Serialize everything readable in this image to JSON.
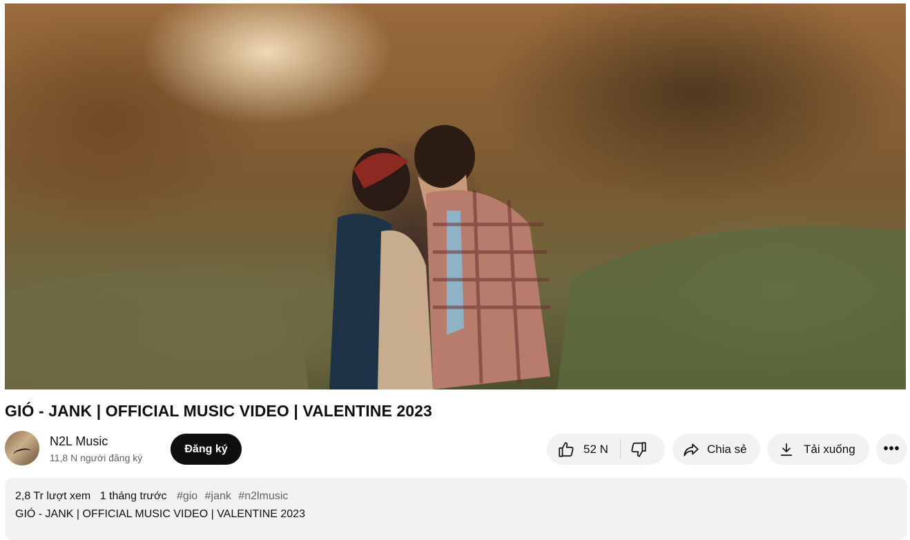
{
  "video": {
    "title": "GIÓ - JANK | OFFICIAL MUSIC VIDEO | VALENTINE 2023"
  },
  "channel": {
    "name": "N2L Music",
    "subscribers": "11,8 N người đăng ký",
    "subscribe_label": "Đăng ký"
  },
  "actions": {
    "like_count": "52 N",
    "share_label": "Chia sẻ",
    "download_label": "Tải xuống"
  },
  "description": {
    "views": "2,8 Tr lượt xem",
    "posted": "1 tháng trước",
    "hashtags": [
      "#gio",
      "#jank",
      "#n2lmusic"
    ],
    "first_line": "GIÓ - JANK | OFFICIAL MUSIC VIDEO | VALENTINE 2023"
  },
  "icons": {
    "like": "thumbs-up-icon",
    "dislike": "thumbs-down-icon",
    "share": "share-arrow-icon",
    "download": "download-icon",
    "more": "more-horizontal-icon"
  }
}
